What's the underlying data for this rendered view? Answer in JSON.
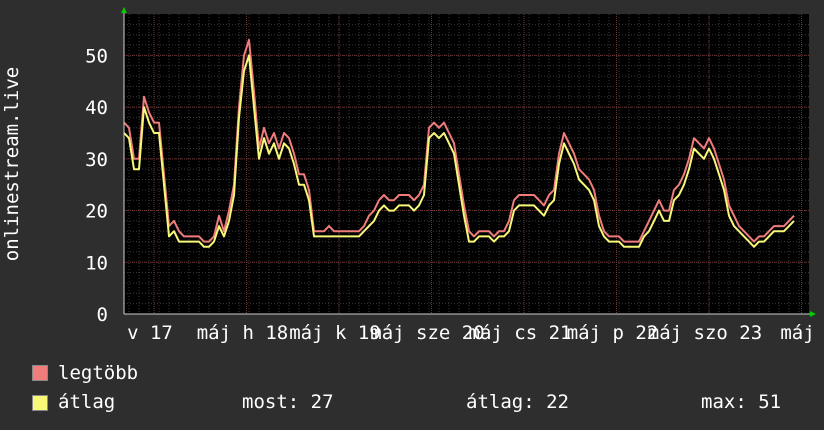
{
  "chart_data": {
    "type": "area",
    "ylabel": "onlinestream.live",
    "ylim": [
      0,
      58
    ],
    "yticks": [
      0,
      10,
      20,
      30,
      40,
      50
    ],
    "xlim": [
      0,
      137
    ],
    "x_ticks": [
      {
        "x": 6,
        "label": "v 17"
      },
      {
        "x": 24.5,
        "label": "máj h 18"
      },
      {
        "x": 43,
        "label": "máj k 19"
      },
      {
        "x": 61.5,
        "label": "máj sze 20"
      },
      {
        "x": 80,
        "label": "máj cs 21"
      },
      {
        "x": 98.5,
        "label": "máj p 22"
      },
      {
        "x": 117,
        "label": "máj szo 23"
      },
      {
        "x": 135.5,
        "label": "máj"
      }
    ],
    "series": [
      {
        "name": "legtöbb",
        "color": "#f07c7c",
        "values": [
          37,
          36,
          30,
          30,
          42,
          39,
          37,
          37,
          27,
          17,
          18,
          16,
          15,
          15,
          15,
          15,
          14,
          14,
          15,
          19,
          16,
          20,
          25,
          40,
          50,
          53,
          43,
          32,
          36,
          33,
          35,
          32,
          35,
          34,
          31,
          27,
          27,
          24,
          16,
          16,
          16,
          17,
          16,
          16,
          16,
          16,
          16,
          16,
          17,
          19,
          20,
          22,
          23,
          22,
          22,
          23,
          23,
          23,
          22,
          23,
          25,
          36,
          37,
          36,
          37,
          35,
          33,
          27,
          21,
          16,
          15,
          16,
          16,
          16,
          15,
          16,
          16,
          18,
          22,
          23,
          23,
          23,
          23,
          22,
          21,
          23,
          24,
          31,
          35,
          33,
          31,
          28,
          27,
          26,
          24,
          19,
          16,
          15,
          15,
          15,
          14,
          14,
          14,
          14,
          16,
          18,
          20,
          22,
          20,
          20,
          24,
          25,
          27,
          30,
          34,
          33,
          32,
          34,
          32,
          29,
          26,
          21,
          19,
          17,
          16,
          15,
          14,
          15,
          15,
          16,
          17,
          17,
          17,
          18,
          19
        ]
      },
      {
        "name": "átlag",
        "color": "#f8f878",
        "values": [
          35,
          34,
          28,
          28,
          40,
          37,
          35,
          35,
          25,
          15,
          16,
          14,
          14,
          14,
          14,
          14,
          13,
          13,
          14,
          17,
          15,
          18,
          23,
          38,
          47,
          50,
          40,
          30,
          34,
          31,
          33,
          30,
          33,
          32,
          29,
          25,
          25,
          22,
          15,
          15,
          15,
          15,
          15,
          15,
          15,
          15,
          15,
          15,
          16,
          17,
          18,
          20,
          21,
          20,
          20,
          21,
          21,
          21,
          20,
          21,
          23,
          34,
          35,
          34,
          35,
          33,
          31,
          25,
          19,
          14,
          14,
          15,
          15,
          15,
          14,
          15,
          15,
          16,
          20,
          21,
          21,
          21,
          21,
          20,
          19,
          21,
          22,
          29,
          33,
          31,
          29,
          26,
          25,
          24,
          22,
          17,
          15,
          14,
          14,
          14,
          13,
          13,
          13,
          13,
          15,
          16,
          18,
          20,
          18,
          18,
          22,
          23,
          25,
          28,
          32,
          31,
          30,
          32,
          30,
          27,
          24,
          19,
          17,
          16,
          15,
          14,
          13,
          14,
          14,
          15,
          16,
          16,
          16,
          17,
          18
        ]
      }
    ],
    "stats": {
      "most_label": "most: 27",
      "atlag_label": "átlag: 22",
      "max_label": "max: 51"
    }
  },
  "colors": {
    "background": "#2e2e2e",
    "plot": "#000000",
    "grid": "#3a3a3a",
    "major_grid": "#6b3232",
    "axis_arrow": "#00cc00"
  }
}
